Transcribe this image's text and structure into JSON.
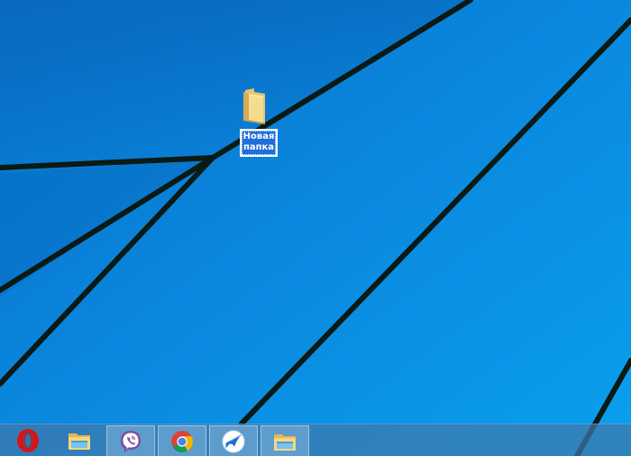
{
  "desktop": {
    "background_color": "#0a86dd",
    "line_color": "#0b1a14",
    "icons": [
      {
        "icon": "folder-icon",
        "label": "Новая\nпапка",
        "selected": true
      }
    ]
  },
  "taskbar": {
    "background_color": "#4078aa",
    "items": [
      {
        "icon": "opera-icon",
        "active": false
      },
      {
        "icon": "file-explorer-icon",
        "active": false
      },
      {
        "icon": "viber-icon",
        "active": true
      },
      {
        "icon": "chrome-icon",
        "active": true
      },
      {
        "icon": "bird-app-icon",
        "active": true
      },
      {
        "icon": "file-explorer-icon",
        "active": true
      }
    ]
  },
  "colors": {
    "opera_red": "#d8141a",
    "viber_purple": "#7b519d",
    "chrome_red": "#db4437",
    "chrome_yellow": "#f4b400",
    "chrome_green": "#0f9d58",
    "chrome_blue": "#4285f4",
    "folder_yellow": "#f3d27a",
    "selection_blue": "#1e6fd9"
  }
}
